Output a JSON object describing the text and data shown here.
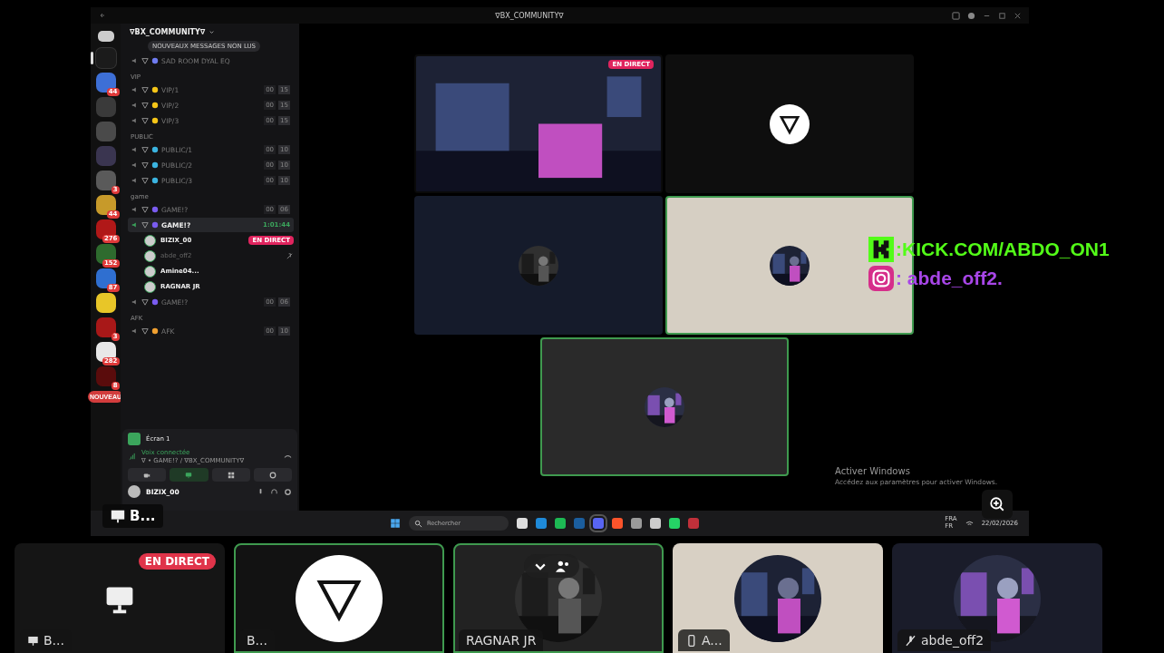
{
  "window": {
    "title": "∇BX_COMMUNITY∇"
  },
  "servers": [
    {
      "color": "#1b1b1b",
      "selected": true
    },
    {
      "color": "#3d6fd6",
      "badge": "44",
      "selected": false
    },
    {
      "color": "#3a3a3a",
      "selected": false
    },
    {
      "color": "#4a4a4a",
      "selected": false
    },
    {
      "color": "#3a3550",
      "selected": false
    },
    {
      "color": "#5a5a5a",
      "badge": "3",
      "selected": false
    },
    {
      "color": "#c79a2a",
      "badge": "44",
      "selected": false
    },
    {
      "color": "#b01818",
      "badge": "276",
      "selected": false
    },
    {
      "color": "#2e6b2e",
      "badge": "152",
      "selected": false
    },
    {
      "color": "#2f6fd0",
      "badge": "87",
      "selected": false
    },
    {
      "color": "#e8c628",
      "selected": false
    },
    {
      "color": "#a81818",
      "badge": "3",
      "selected": false
    },
    {
      "color": "#e8e8e8",
      "badge": "282",
      "selected": false
    },
    {
      "color": "#5a0c0c",
      "badge": "8",
      "selected": false
    }
  ],
  "new_badge": "NOUVEAU",
  "server": {
    "name": "∇BX_COMMUNITY∇"
  },
  "tooltip": "NOUVEAUX MESSAGES NON LUS",
  "channels": [
    {
      "kind": "voice",
      "name": "SAD ROOM DYAL EQ",
      "color": "#6f7cf0",
      "selected": false
    },
    {
      "kind": "category",
      "name": "VIP"
    },
    {
      "kind": "voice",
      "name": "VIP/1",
      "color": "#f5c518",
      "users": "00",
      "limit": "15",
      "selected": false
    },
    {
      "kind": "voice",
      "name": "VIP/2",
      "color": "#f5c518",
      "users": "00",
      "limit": "15",
      "selected": false
    },
    {
      "kind": "voice",
      "name": "VIP/3",
      "color": "#f5c518",
      "users": "00",
      "limit": "15",
      "selected": false
    },
    {
      "kind": "category",
      "name": "PUBLIC"
    },
    {
      "kind": "voice",
      "name": "PUBLIC/1",
      "color": "#3bb4e0",
      "users": "00",
      "limit": "10",
      "selected": false
    },
    {
      "kind": "voice",
      "name": "PUBLIC/2",
      "color": "#3bb4e0",
      "users": "00",
      "limit": "10",
      "selected": false
    },
    {
      "kind": "voice",
      "name": "PUBLIC/3",
      "color": "#3bb4e0",
      "users": "00",
      "limit": "10",
      "selected": false
    },
    {
      "kind": "category",
      "name": "game"
    },
    {
      "kind": "voice",
      "name": "GAME!?",
      "color": "#7a5cf0",
      "users": "00",
      "limit": "06",
      "selected": false
    },
    {
      "kind": "voice",
      "name": "GAME!?",
      "color": "#7a5cf0",
      "timer": "1:01:44",
      "selected": true,
      "members": [
        {
          "name": "BIZIX_00",
          "badge": "EN DIRECT",
          "muted": false
        },
        {
          "name": "abde_off2",
          "muted": true
        },
        {
          "name": "Amine04...",
          "muted": false
        },
        {
          "name": "RAGNAR JR",
          "muted": false
        }
      ]
    },
    {
      "kind": "voice",
      "name": "GAME!?",
      "color": "#7a5cf0",
      "users": "00",
      "limit": "06",
      "selected": false
    },
    {
      "kind": "category",
      "name": "AFK"
    },
    {
      "kind": "voice",
      "name": "AFK",
      "color": "#f0a030",
      "users": "00",
      "limit": "10",
      "selected": false
    }
  ],
  "voice_panel": {
    "screen_label": "Écran 1",
    "status": "Voix connectée",
    "location": "∇ • GAME!? / ∇BX_COMMUNITY∇",
    "actions": [
      {
        "kind": "camera",
        "selected": false
      },
      {
        "kind": "screen",
        "selected": true
      },
      {
        "kind": "activity",
        "selected": false
      },
      {
        "kind": "soundboard",
        "selected": false
      }
    ]
  },
  "user": {
    "name": "BIZIX_00"
  },
  "stream_label": "B...",
  "video_tiles": [
    {
      "kind": "screen",
      "badge": "EN DIRECT",
      "color": "#0a0a0a",
      "speaking": false
    },
    {
      "kind": "logo",
      "color": "#0e0e0e",
      "speaking": false
    },
    {
      "kind": "picture",
      "color": "#151b2b",
      "speaking": false
    },
    {
      "kind": "picture",
      "color": "#d6cfc3",
      "speaking": true
    },
    {
      "kind": "picture",
      "color": "#2a2a2a",
      "speaking": true
    }
  ],
  "activation": {
    "title": "Activer Windows",
    "text": "Accédez aux paramètres pour activer Windows."
  },
  "taskbar": {
    "search_placeholder": "Rechercher",
    "apps": [
      {
        "color": "#dddddd",
        "selected": false
      },
      {
        "color": "#1f8ad8",
        "selected": false
      },
      {
        "color": "#1db954",
        "selected": false
      },
      {
        "color": "#1b5e9e",
        "selected": false
      },
      {
        "color": "#5865f2",
        "selected": true
      },
      {
        "color": "#fb542b",
        "selected": false
      },
      {
        "color": "#9a9a9a",
        "selected": false
      },
      {
        "color": "#cccccc",
        "selected": false
      },
      {
        "color": "#25d366",
        "selected": false
      },
      {
        "color": "#c0303a",
        "selected": false
      }
    ],
    "language": "FRA",
    "layout": "FR",
    "date": "22/02/2026"
  },
  "social": [
    {
      "kind": "kick",
      "text": ":KICK.COM/ABDO_ON1"
    },
    {
      "kind": "instagram",
      "text": ": abde_off2."
    }
  ],
  "call_tiles": [
    {
      "kind": "screen",
      "badge": "EN DIRECT",
      "label": {
        "kind": "monitor",
        "text": "B..."
      },
      "color": "#151515",
      "speaking": false
    },
    {
      "kind": "logo",
      "label": {
        "text": "B..."
      },
      "color": "#121212",
      "speaking": true
    },
    {
      "kind": "picture",
      "label": {
        "text": "RAGNAR JR"
      },
      "color": "#222222",
      "speaking": true,
      "controls": true
    },
    {
      "kind": "picture",
      "label": {
        "kind": "phone",
        "text": "A..."
      },
      "color": "#d8d0c4",
      "speaking": false
    },
    {
      "kind": "picture",
      "label": {
        "kind": "muted",
        "text": "abde_off2"
      },
      "color": "#1a1c2a",
      "speaking": false
    }
  ]
}
